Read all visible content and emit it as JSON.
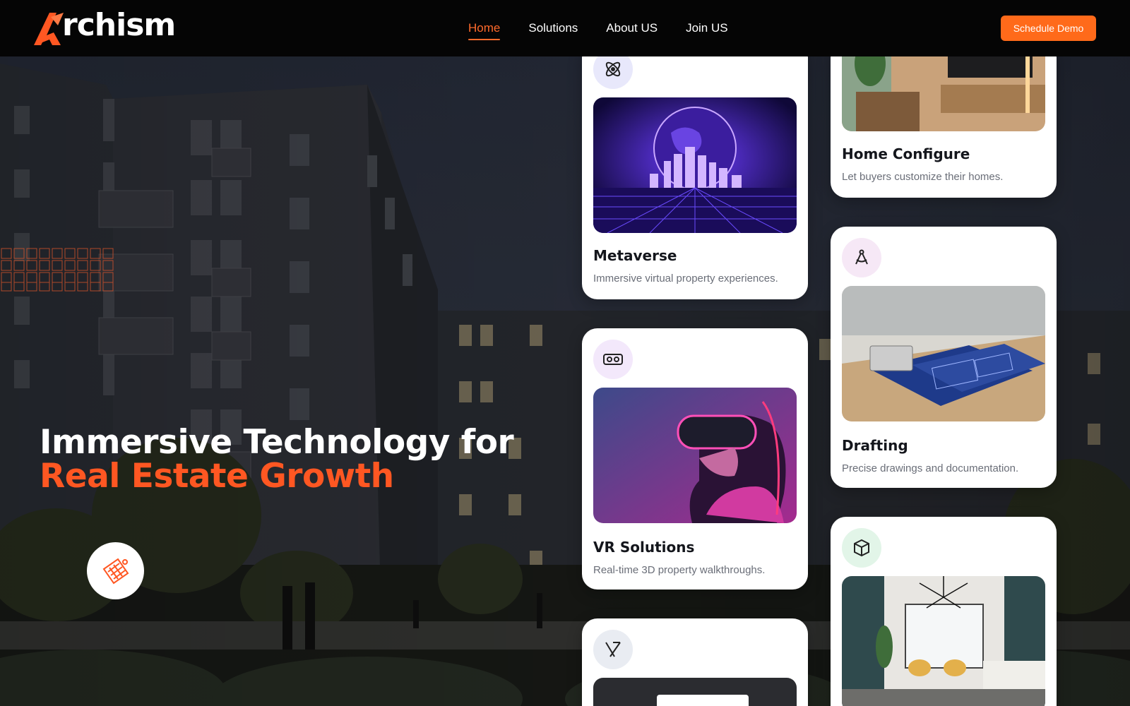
{
  "brand": {
    "logo_text": "rchism",
    "accent": "#ff5722",
    "button_color": "#ff6a1a"
  },
  "nav": {
    "items": [
      {
        "label": "Home",
        "active": true
      },
      {
        "label": "Solutions",
        "active": false
      },
      {
        "label": "About US",
        "active": false
      },
      {
        "label": "Join US",
        "active": false
      }
    ],
    "cta_label": "Schedule Demo"
  },
  "hero": {
    "title_line1": "Immersive Technology for",
    "title_line2": "Real Estate Growth",
    "badge_icon": "blueprint-icon"
  },
  "cards": {
    "metaverse": {
      "title": "Metaverse",
      "desc": "Immersive virtual property experiences.",
      "icon": "atom-icon",
      "icon_bg": "#e8e8fb"
    },
    "vr": {
      "title": "VR Solutions",
      "desc": "Real-time 3D property walkthroughs.",
      "icon": "vr-headset-icon",
      "icon_bg": "#f3e8fb"
    },
    "xr": {
      "title": "",
      "desc": "",
      "icon": "xr-icon",
      "icon_bg": "#e9ecf2"
    },
    "home_configure": {
      "title": "Home Configure",
      "desc": "Let buyers customize their homes.",
      "icon": "",
      "icon_bg": ""
    },
    "drafting": {
      "title": "Drafting",
      "desc": "Precise drawings and documentation.",
      "icon": "compass-icon",
      "icon_bg": "#f6e8f6"
    },
    "interior": {
      "title": "",
      "desc": "",
      "icon": "cube-icon",
      "icon_bg": "#e2f5e8"
    }
  }
}
